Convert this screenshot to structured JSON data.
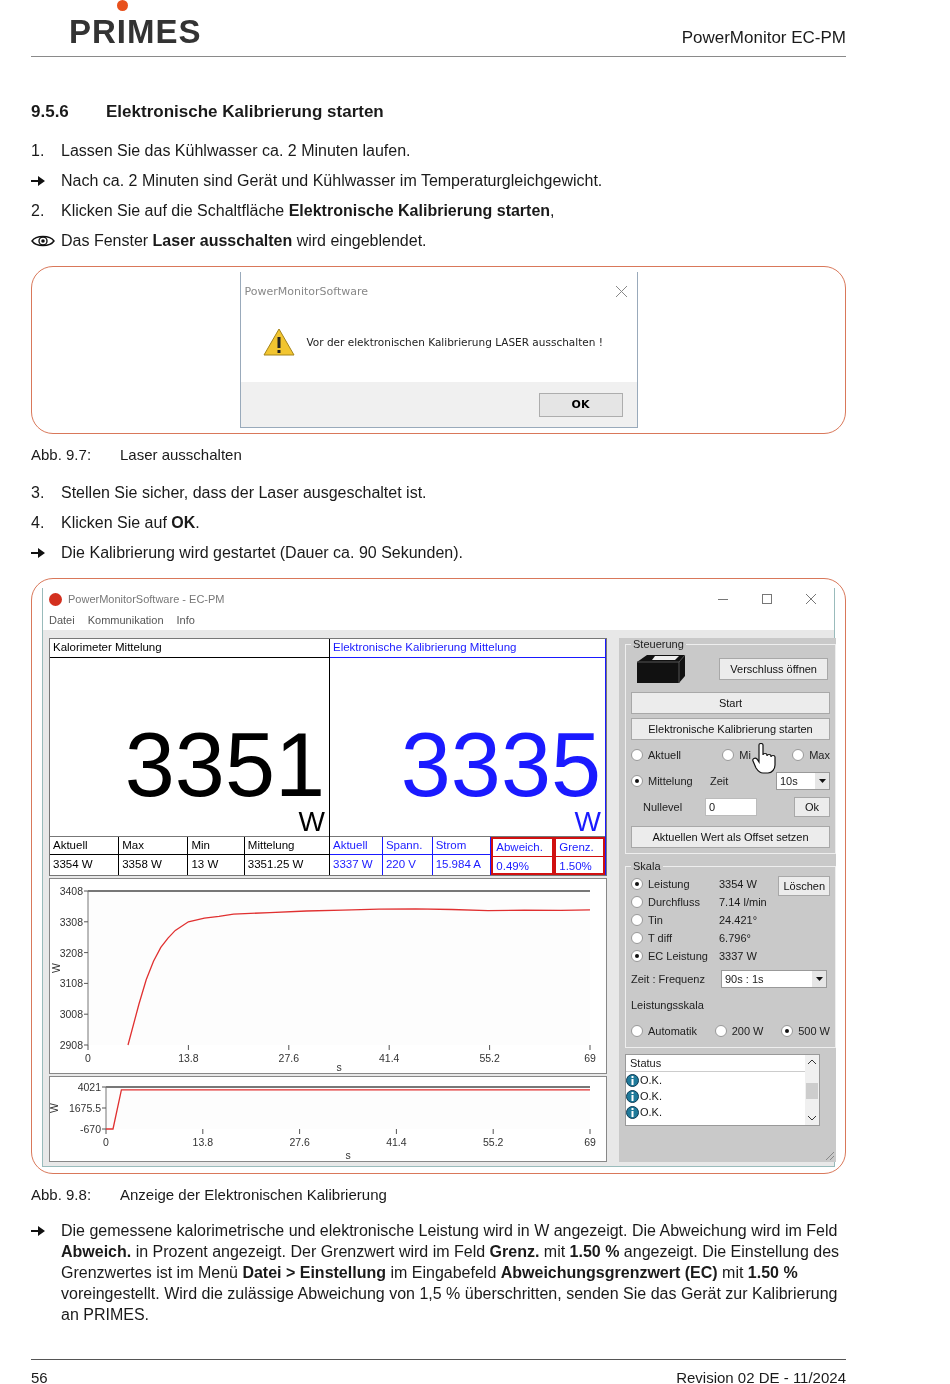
{
  "header": {
    "logo": "PRIMES",
    "title": "PowerMonitor EC-PM"
  },
  "section": {
    "number": "9.5.6",
    "title": "Elektronische Kalibrierung starten"
  },
  "steps_1": [
    {
      "kind": "numbered",
      "marker": "1.",
      "text": "Lassen Sie das Kühlwasser ca. 2 Minuten laufen."
    },
    {
      "kind": "result",
      "text": "Nach ca. 2 Minuten sind Gerät und Kühlwasser im Temperaturgleichgewicht."
    },
    {
      "kind": "numbered",
      "marker": "2.",
      "text": "Klicken Sie auf die Schaltfläche **Elektronische Kalibrierung starten**,"
    },
    {
      "kind": "view",
      "text": "Das Fenster **Laser ausschalten** wird eingeblendet."
    }
  ],
  "dialog": {
    "title": "PowerMonitorSoftware",
    "message": "Vor der elektronischen Kalibrierung LASER ausschalten !",
    "button": "OK"
  },
  "caption_1": {
    "label": "Abb. 9.7:",
    "text": "Laser ausschalten"
  },
  "steps_2": [
    {
      "kind": "numbered",
      "marker": "3.",
      "text": "Stellen Sie sicher, dass der Laser ausgeschaltet ist."
    },
    {
      "kind": "numbered",
      "marker": "4.",
      "text": "Klicken Sie auf **OK**."
    },
    {
      "kind": "result",
      "text": "Die Kalibrierung wird gestartet (Dauer ca. 90 Sekunden)."
    }
  ],
  "app": {
    "title": "PowerMonitorSoftware - EC-PM",
    "menu": [
      "Datei",
      "Kommunikation",
      "Info"
    ],
    "panels": [
      {
        "title": "Kalorimeter Mittelung",
        "value": "3351",
        "unit": "W",
        "color": "#000000",
        "columns": [
          {
            "label": "Aktuell",
            "value": "3354 W",
            "highlighted": false
          },
          {
            "label": "Max",
            "value": "3358 W",
            "highlighted": false
          },
          {
            "label": "Min",
            "value": "13 W",
            "highlighted": false
          },
          {
            "label": "Mittelung",
            "value": "3351.25 W",
            "highlighted": false
          }
        ]
      },
      {
        "title": "Elektronische Kalibrierung Mittelung",
        "value": "3335",
        "unit": "W",
        "color": "#1a1aff",
        "columns": [
          {
            "label": "Aktuell",
            "value": "3337 W",
            "highlighted": false
          },
          {
            "label": "Spann.",
            "value": "220 V",
            "highlighted": false
          },
          {
            "label": "Strom",
            "value": "15.984 A",
            "highlighted": false
          },
          {
            "label": "Abweich.",
            "value": "0.49%",
            "highlighted": true
          },
          {
            "label": "Grenz.",
            "value": "1.50%",
            "highlighted": true
          }
        ]
      }
    ],
    "plots": [
      {
        "chart_data": {
          "type": "line",
          "xlabel": "s",
          "ylabel": "W",
          "xlim": [
            0,
            69
          ],
          "ylim": [
            2908,
            3408
          ],
          "xticks": [
            0,
            13.8,
            27.6,
            41.4,
            55.2,
            69
          ],
          "yticks": [
            2908,
            3008,
            3108,
            3208,
            3308,
            3408
          ],
          "x": [
            5.5,
            7,
            8,
            9,
            10,
            11,
            12,
            13.8,
            16,
            18,
            20,
            25,
            30,
            35,
            40,
            45,
            50,
            55,
            60,
            65,
            69
          ],
          "series": [
            {
              "color": "#e03030",
              "values": [
                2908,
                3040,
                3120,
                3180,
                3225,
                3255,
                3280,
                3308,
                3320,
                3326,
                3333,
                3338,
                3343,
                3346,
                3349,
                3350,
                3348,
                3344,
                3346,
                3345,
                3347
              ]
            }
          ]
        }
      },
      {
        "chart_data": {
          "type": "line",
          "xlabel": "s",
          "ylabel": "W",
          "xlim": [
            0,
            69
          ],
          "ylim": [
            -670,
            4021
          ],
          "xticks": [
            0,
            13.8,
            27.6,
            41.4,
            55.2,
            69
          ],
          "yticks": [
            -670,
            1675.5,
            4021
          ],
          "x": [
            0,
            1,
            2.2,
            69
          ],
          "series": [
            {
              "color": "#e03030",
              "values": [
                -670,
                -670,
                3700,
                3700
              ]
            }
          ]
        }
      }
    ],
    "control": {
      "title": "Steuerung",
      "shutter_button": "Verschluss öffnen",
      "start_button": "Start",
      "calibration_button": "Elektronische Kalibrierung starten",
      "mode_radios": [
        {
          "label": "Aktuell",
          "selected": false
        },
        {
          "label": "Mi",
          "selected": false
        },
        {
          "label": "Max",
          "selected": false
        },
        {
          "label": "Mittelung",
          "selected": true
        }
      ],
      "time_label": "Zeit",
      "time_select": "10s",
      "null_label": "Nullevel",
      "null_value": "0",
      "ok_button": "Ok",
      "offset_button": "Aktuellen Wert als Offset setzen"
    },
    "scale": {
      "title": "Skala",
      "clear_button": "Löschen",
      "channels": [
        {
          "label": "Leistung",
          "reading": "3354 W",
          "selected": true
        },
        {
          "label": "Durchfluss",
          "reading": "7.14 l/min",
          "selected": false
        },
        {
          "label": "Tin",
          "reading": "24.421°",
          "selected": false
        },
        {
          "label": "T diff",
          "reading": "6.796°",
          "selected": false
        },
        {
          "label": "EC Leistung",
          "reading": "3337 W",
          "selected": true
        }
      ],
      "frequency_label": "Zeit : Frequenz",
      "frequency_select": "90s : 1s",
      "range_label": "Leistungsskala",
      "ranges": [
        {
          "label": "Automatik",
          "selected": false
        },
        {
          "label": "200 W",
          "selected": false
        },
        {
          "label": "500 W",
          "selected": true
        }
      ]
    },
    "status": {
      "header": "Status",
      "items": [
        "O.K.",
        "O.K.",
        "O.K."
      ]
    }
  },
  "caption_2": {
    "label": "Abb. 9.8:",
    "text": "Anzeige der Elektronischen Kalibrierung"
  },
  "note": "Die gemessene kalorimetrische und elektronische Leistung wird in W angezeigt. Die Abweichung wird im Feld **Abweich.** in Prozent angezeigt. Der Grenzwert wird im Feld **Grenz.** mit **1.50 %** angezeigt. Die Einstellung des Grenzwertes ist im Menü **Datei > Einstellung** im Eingabefeld **Abweichungsgrenzwert (EC)** mit **1.50 %** voreingestellt. Wird die zulässige Abweichung von 1,5 % überschritten, senden Sie das Gerät zur Kalibrierung an PRIMES.",
  "footer": {
    "page": "56",
    "revision": "Revision 02 DE - 11/2024"
  }
}
